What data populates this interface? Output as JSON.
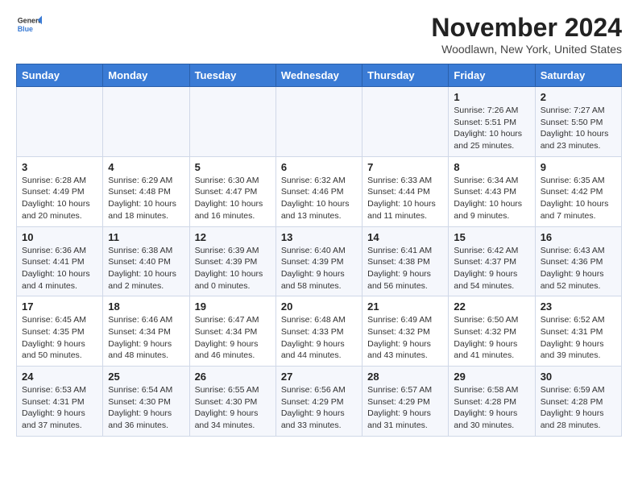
{
  "header": {
    "logo_general": "General",
    "logo_blue": "Blue",
    "month_title": "November 2024",
    "location": "Woodlawn, New York, United States"
  },
  "weekdays": [
    "Sunday",
    "Monday",
    "Tuesday",
    "Wednesday",
    "Thursday",
    "Friday",
    "Saturday"
  ],
  "weeks": [
    [
      {
        "day": "",
        "info": ""
      },
      {
        "day": "",
        "info": ""
      },
      {
        "day": "",
        "info": ""
      },
      {
        "day": "",
        "info": ""
      },
      {
        "day": "",
        "info": ""
      },
      {
        "day": "1",
        "info": "Sunrise: 7:26 AM\nSunset: 5:51 PM\nDaylight: 10 hours and 25 minutes."
      },
      {
        "day": "2",
        "info": "Sunrise: 7:27 AM\nSunset: 5:50 PM\nDaylight: 10 hours and 23 minutes."
      }
    ],
    [
      {
        "day": "3",
        "info": "Sunrise: 6:28 AM\nSunset: 4:49 PM\nDaylight: 10 hours and 20 minutes."
      },
      {
        "day": "4",
        "info": "Sunrise: 6:29 AM\nSunset: 4:48 PM\nDaylight: 10 hours and 18 minutes."
      },
      {
        "day": "5",
        "info": "Sunrise: 6:30 AM\nSunset: 4:47 PM\nDaylight: 10 hours and 16 minutes."
      },
      {
        "day": "6",
        "info": "Sunrise: 6:32 AM\nSunset: 4:46 PM\nDaylight: 10 hours and 13 minutes."
      },
      {
        "day": "7",
        "info": "Sunrise: 6:33 AM\nSunset: 4:44 PM\nDaylight: 10 hours and 11 minutes."
      },
      {
        "day": "8",
        "info": "Sunrise: 6:34 AM\nSunset: 4:43 PM\nDaylight: 10 hours and 9 minutes."
      },
      {
        "day": "9",
        "info": "Sunrise: 6:35 AM\nSunset: 4:42 PM\nDaylight: 10 hours and 7 minutes."
      }
    ],
    [
      {
        "day": "10",
        "info": "Sunrise: 6:36 AM\nSunset: 4:41 PM\nDaylight: 10 hours and 4 minutes."
      },
      {
        "day": "11",
        "info": "Sunrise: 6:38 AM\nSunset: 4:40 PM\nDaylight: 10 hours and 2 minutes."
      },
      {
        "day": "12",
        "info": "Sunrise: 6:39 AM\nSunset: 4:39 PM\nDaylight: 10 hours and 0 minutes."
      },
      {
        "day": "13",
        "info": "Sunrise: 6:40 AM\nSunset: 4:39 PM\nDaylight: 9 hours and 58 minutes."
      },
      {
        "day": "14",
        "info": "Sunrise: 6:41 AM\nSunset: 4:38 PM\nDaylight: 9 hours and 56 minutes."
      },
      {
        "day": "15",
        "info": "Sunrise: 6:42 AM\nSunset: 4:37 PM\nDaylight: 9 hours and 54 minutes."
      },
      {
        "day": "16",
        "info": "Sunrise: 6:43 AM\nSunset: 4:36 PM\nDaylight: 9 hours and 52 minutes."
      }
    ],
    [
      {
        "day": "17",
        "info": "Sunrise: 6:45 AM\nSunset: 4:35 PM\nDaylight: 9 hours and 50 minutes."
      },
      {
        "day": "18",
        "info": "Sunrise: 6:46 AM\nSunset: 4:34 PM\nDaylight: 9 hours and 48 minutes."
      },
      {
        "day": "19",
        "info": "Sunrise: 6:47 AM\nSunset: 4:34 PM\nDaylight: 9 hours and 46 minutes."
      },
      {
        "day": "20",
        "info": "Sunrise: 6:48 AM\nSunset: 4:33 PM\nDaylight: 9 hours and 44 minutes."
      },
      {
        "day": "21",
        "info": "Sunrise: 6:49 AM\nSunset: 4:32 PM\nDaylight: 9 hours and 43 minutes."
      },
      {
        "day": "22",
        "info": "Sunrise: 6:50 AM\nSunset: 4:32 PM\nDaylight: 9 hours and 41 minutes."
      },
      {
        "day": "23",
        "info": "Sunrise: 6:52 AM\nSunset: 4:31 PM\nDaylight: 9 hours and 39 minutes."
      }
    ],
    [
      {
        "day": "24",
        "info": "Sunrise: 6:53 AM\nSunset: 4:31 PM\nDaylight: 9 hours and 37 minutes."
      },
      {
        "day": "25",
        "info": "Sunrise: 6:54 AM\nSunset: 4:30 PM\nDaylight: 9 hours and 36 minutes."
      },
      {
        "day": "26",
        "info": "Sunrise: 6:55 AM\nSunset: 4:30 PM\nDaylight: 9 hours and 34 minutes."
      },
      {
        "day": "27",
        "info": "Sunrise: 6:56 AM\nSunset: 4:29 PM\nDaylight: 9 hours and 33 minutes."
      },
      {
        "day": "28",
        "info": "Sunrise: 6:57 AM\nSunset: 4:29 PM\nDaylight: 9 hours and 31 minutes."
      },
      {
        "day": "29",
        "info": "Sunrise: 6:58 AM\nSunset: 4:28 PM\nDaylight: 9 hours and 30 minutes."
      },
      {
        "day": "30",
        "info": "Sunrise: 6:59 AM\nSunset: 4:28 PM\nDaylight: 9 hours and 28 minutes."
      }
    ]
  ]
}
